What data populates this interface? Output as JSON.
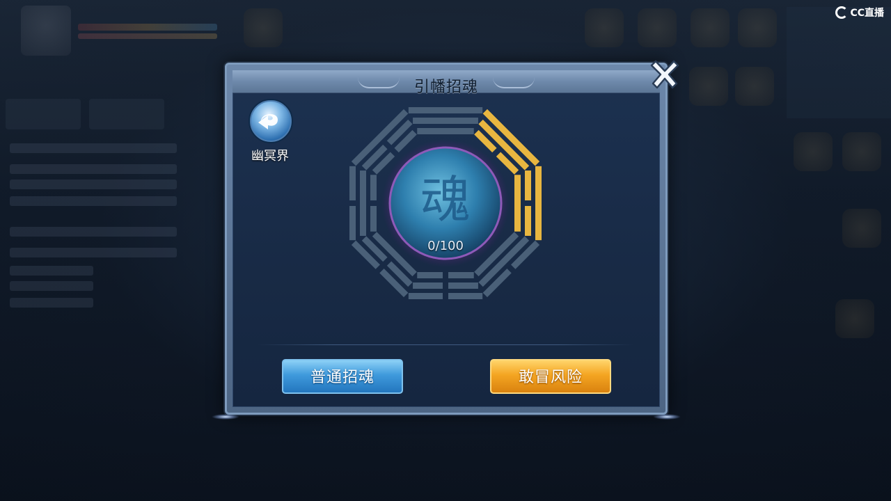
{
  "dialog": {
    "title": "引幡招魂",
    "return_label": "幽冥界",
    "counter": "0/100",
    "center_glyph": "魂",
    "buttons": {
      "normal": "普通招魂",
      "risk": "敢冒风险"
    }
  },
  "watermark": {
    "brand": "CC直播"
  },
  "icons": {
    "close": "close-x-icon",
    "return": "return-arrow-icon"
  },
  "colors": {
    "trigram_active": "#e8b640",
    "trigram_inactive": "#4a6078",
    "button_blue": "#3f9adc",
    "button_orange": "#f4a522"
  },
  "bagua": {
    "active_trigrams": 2,
    "total_trigrams": 8
  }
}
